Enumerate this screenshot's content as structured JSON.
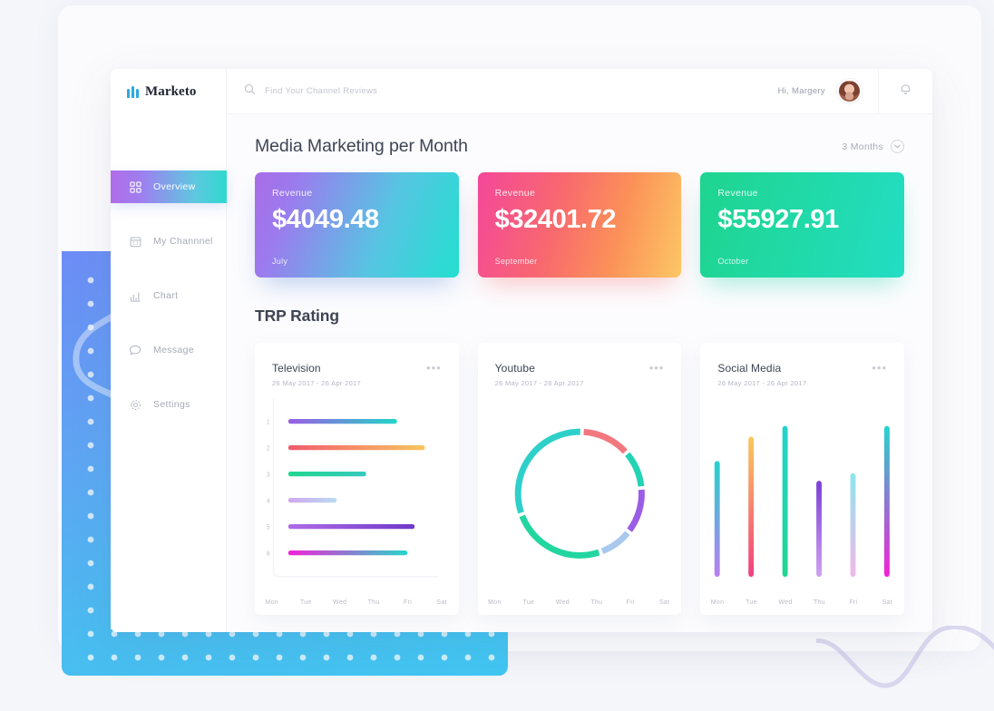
{
  "brand": {
    "name": "Marketo",
    "mark": "bars-logo-icon"
  },
  "sidebar": {
    "items": [
      {
        "label": "Overview",
        "icon": "grid-icon",
        "active": true
      },
      {
        "label": "My Channnel",
        "icon": "calendar-icon",
        "active": false
      },
      {
        "label": "Chart",
        "icon": "bar-chart-icon",
        "active": false
      },
      {
        "label": "Message",
        "icon": "chat-icon",
        "active": false
      },
      {
        "label": "Settings",
        "icon": "gear-icon",
        "active": false
      }
    ]
  },
  "topbar": {
    "search": {
      "placeholder": "Find Your Channel Reviews",
      "value": "",
      "icon": "search-icon"
    },
    "greeting": "Hi, Margery",
    "avatar": "user-avatar",
    "bell": "bell-icon"
  },
  "main": {
    "page_title": "Media Marketing per Month",
    "range": {
      "label": "3 Months",
      "icon": "chevron-down-circle-icon"
    },
    "revenue_cards": [
      {
        "label": "Revenue",
        "value": "$4049.48",
        "month": "July",
        "accent": "#a96ce6"
      },
      {
        "label": "Revenue",
        "value": "$32401.72",
        "month": "September",
        "accent": "#f4479a"
      },
      {
        "label": "Revenue",
        "value": "$55927.91",
        "month": "October",
        "accent": "#1fd48f"
      }
    ],
    "trp_title": "TRP Rating",
    "trp_cards": [
      {
        "name": "Television",
        "date": "26 May 2017  -  26 Apr 2017",
        "menu": "more-options-icon"
      },
      {
        "name": "Youtube",
        "date": "26 May 2017  -  26 Apr 2017",
        "menu": "more-options-icon"
      },
      {
        "name": "Social Media",
        "date": "26 May 2017  -  26 Apr 2017",
        "menu": "more-options-icon"
      }
    ]
  },
  "chart_data": [
    {
      "type": "bar",
      "orientation": "horizontal",
      "title": "Television",
      "xlabel": "",
      "ylabel": "",
      "categories": [
        "1",
        "2",
        "3",
        "4",
        "5",
        "6"
      ],
      "tick_labels_x": [
        "Mon",
        "Tue",
        "Wed",
        "Thu",
        "Fri",
        "Sat"
      ],
      "values": [
        74,
        93,
        53,
        33,
        86,
        81
      ],
      "xlim": [
        0,
        100
      ],
      "grid": false,
      "legend": "none",
      "colors": [
        {
          "from": "#9b5de5",
          "to": "#20d6c8"
        },
        {
          "from": "#f05b6e",
          "to": "#fbc55e"
        },
        {
          "from": "#20d68f",
          "to": "#35c9bd"
        },
        {
          "from": "#cfa7ef",
          "to": "#b9dcf3"
        },
        {
          "from": "#b06ce8",
          "to": "#6f39c9"
        },
        {
          "from": "#f221d6",
          "to": "#25d6c9"
        }
      ]
    },
    {
      "type": "pie",
      "variant": "donut",
      "title": "Youtube",
      "tick_labels_x": [
        "Mon",
        "Tue",
        "Wed",
        "Thu",
        "Fri",
        "Sat"
      ],
      "labels": [
        "Mon",
        "Tue",
        "Wed",
        "Thu",
        "Fri",
        "Sat"
      ],
      "values": [
        13,
        10,
        12,
        9,
        25,
        31
      ],
      "colors": [
        "#f2787f",
        "#22d3b4",
        "#9b5de5",
        "#a9c8ee",
        "#22d6a0",
        "#2fd0c9"
      ],
      "legend": "bottom-axis",
      "grid": false
    },
    {
      "type": "bar",
      "orientation": "vertical",
      "title": "Social Media",
      "xlabel": "",
      "ylabel": "",
      "categories": [
        "Mon",
        "Tue",
        "Wed",
        "Thu",
        "Fri",
        "Sat"
      ],
      "tick_labels_x": [
        "Mon",
        "Tue",
        "Wed",
        "Thu",
        "Fri",
        "Sat"
      ],
      "values": [
        76,
        92,
        99,
        63,
        68,
        99
      ],
      "ylim": [
        0,
        100
      ],
      "grid": false,
      "legend": "none",
      "colors": [
        {
          "from": "#25d3cd",
          "to": "#b97ef0"
        },
        {
          "from": "#f9c95c",
          "to": "#f0407f"
        },
        {
          "from": "#25d3cd",
          "to": "#21d691"
        },
        {
          "from": "#7b40d6",
          "to": "#cda2ef"
        },
        {
          "from": "#8fe4ee",
          "to": "#f0b8e8"
        },
        {
          "from": "#25d3cd",
          "to": "#f221d6"
        }
      ]
    }
  ]
}
